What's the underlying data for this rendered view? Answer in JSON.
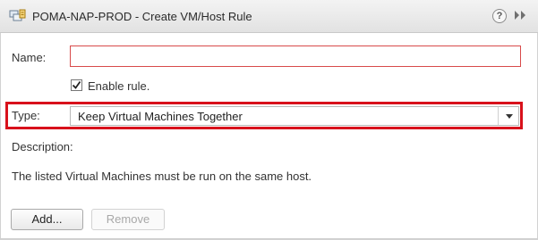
{
  "dialog": {
    "title": "POMA-NAP-PROD - Create VM/Host Rule",
    "help_glyph": "?",
    "icons": {
      "title": "cluster-rule-icon",
      "help": "help-icon",
      "expand": "expand-panel-icon"
    }
  },
  "form": {
    "name_label": "Name:",
    "name_value": "",
    "name_placeholder": "",
    "enable_label": "Enable rule.",
    "enable_checked": true,
    "type_label": "Type:",
    "type_value": "Keep Virtual Machines Together",
    "description_label": "Description:",
    "description_text": "The listed Virtual Machines must be run on the same host."
  },
  "buttons": {
    "add": "Add...",
    "remove": "Remove",
    "remove_enabled": false
  },
  "colors": {
    "highlight": "#d8111b",
    "invalid_border": "#d84a4a"
  }
}
